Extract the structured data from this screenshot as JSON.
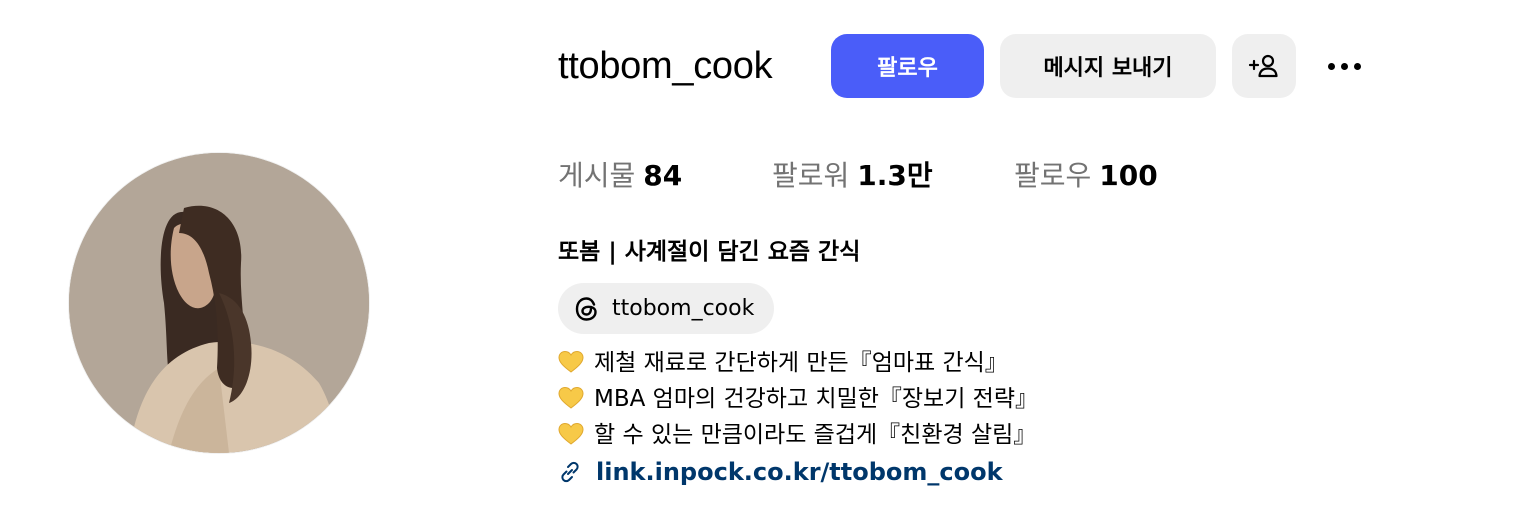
{
  "profile": {
    "username": "ttobom_cook",
    "display_name": "또봄 | 사계절이 담긴 요즘 간식",
    "threads_handle": "ttobom_cook"
  },
  "actions": {
    "follow_label": "팔로우",
    "message_label": "메시지 보내기",
    "add_person_icon": "add-person-icon",
    "more_icon": "more-options-icon"
  },
  "stats": {
    "posts_label": "게시물",
    "posts_value": "84",
    "followers_label": "팔로워",
    "followers_value": "1.3만",
    "following_label": "팔로우",
    "following_value": "100"
  },
  "bio": {
    "lines": [
      "제철 재료로 간단하게 만든『엄마표 간식』",
      "MBA 엄마의 건강하고 치밀한『장보기 전략』",
      "할 수 있는 만큼이라도 즐겁게『친환경 살림』"
    ],
    "line_icon": "yellow-heart-icon",
    "link": "link.inpock.co.kr/ttobom_cook"
  },
  "colors": {
    "accent": "#4a5df9",
    "secondary_button": "#efefef",
    "muted_text": "#737373",
    "link": "#00376b",
    "heart": "#f7c948"
  }
}
